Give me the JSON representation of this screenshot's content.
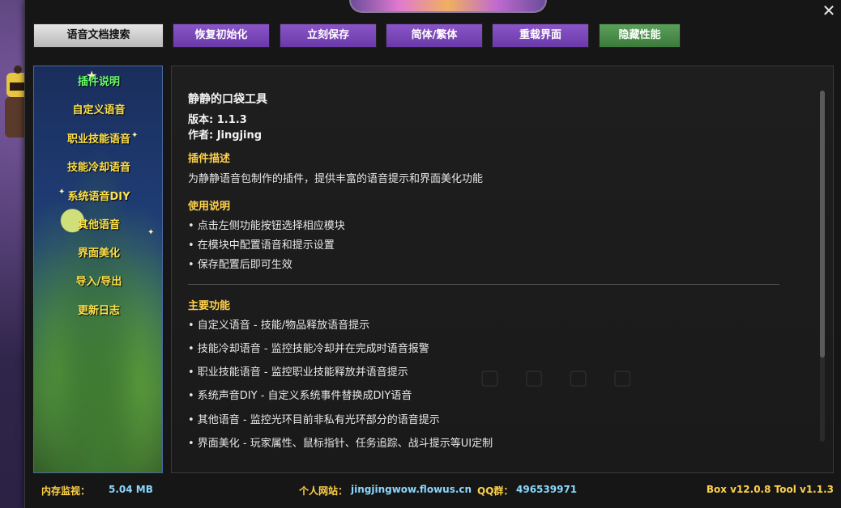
{
  "toolbar": {
    "search": "语音文档搜索",
    "reset": "恢复初始化",
    "save": "立刻保存",
    "lang": "简体/繁体",
    "reload": "重载界面",
    "perf": "隐藏性能"
  },
  "sidebar": {
    "items": [
      {
        "label": "插件说明",
        "active": true
      },
      {
        "label": "自定义语音"
      },
      {
        "label": "职业技能语音"
      },
      {
        "label": "技能冷却语音"
      },
      {
        "label": "系统语音DIY"
      },
      {
        "label": "其他语音"
      },
      {
        "label": "界面美化"
      },
      {
        "label": "导入/导出"
      },
      {
        "label": "更新日志"
      }
    ]
  },
  "content": {
    "title": "静静的口袋工具",
    "version": "版本: 1.1.3",
    "author": "作者: Jingjing",
    "desc_heading": "插件描述",
    "desc_text": "为静静语音包制作的插件，提供丰富的语音提示和界面美化功能",
    "usage_heading": "使用说明",
    "usage": [
      "• 点击左侧功能按钮选择相应模块",
      "• 在模块中配置语音和提示设置",
      "• 保存配置后即可生效"
    ],
    "features_heading": "主要功能",
    "features": [
      "• 自定义语音 - 技能/物品释放语音提示",
      "• 技能冷却语音 - 监控技能冷却并在完成时语音报警",
      "• 职业技能语音 - 监控职业技能释放并语音提示",
      "• 系统声音DIY - 自定义系统事件替换成DIY语音",
      "• 其他语音 - 监控光环目前非私有光环部分的语音提示",
      "• 界面美化 - 玩家属性、鼠标指针、任务追踪、战斗提示等UI定制"
    ]
  },
  "status": {
    "memory_label": "内存监视：",
    "memory_value": "5.04 MB",
    "site_label": "个人网站：",
    "site": "jingjingwow.flowus.cn",
    "qq_label": "QQ群：",
    "qq": "496539971",
    "version": "Box v12.0.8  Tool v1.1.3"
  },
  "colors": {
    "accent_purple": "#7a48b8",
    "accent_green": "#4a8e4a",
    "heading_yellow": "#ffd24a",
    "link_blue": "#8ad8ff",
    "active_green": "#6cff6c"
  },
  "scrollbar_position": 0
}
